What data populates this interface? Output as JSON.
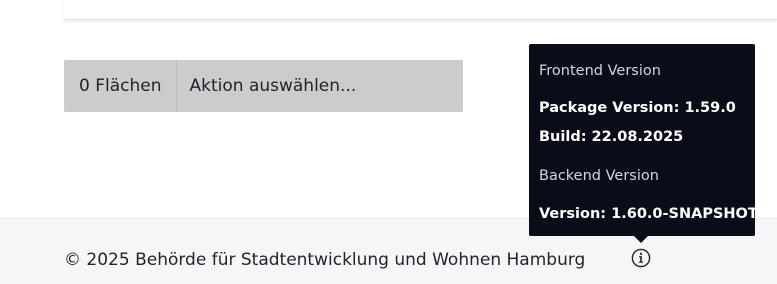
{
  "selection": {
    "count_label": "0 Flächen",
    "action_placeholder": "Aktion auswählen..."
  },
  "footer": {
    "copyright": "© 2025 Behörde für Stadtentwicklung und Wohnen Hamburg",
    "info_icon": "info-circle-icon"
  },
  "version_tooltip": {
    "frontend_heading": "Frontend Version",
    "package_version": "Package Version: 1.59.0",
    "build": "Build: 22.08.2025",
    "backend_heading": "Backend Version",
    "backend_version": "Version: 1.60.0-SNAPSHOT"
  }
}
